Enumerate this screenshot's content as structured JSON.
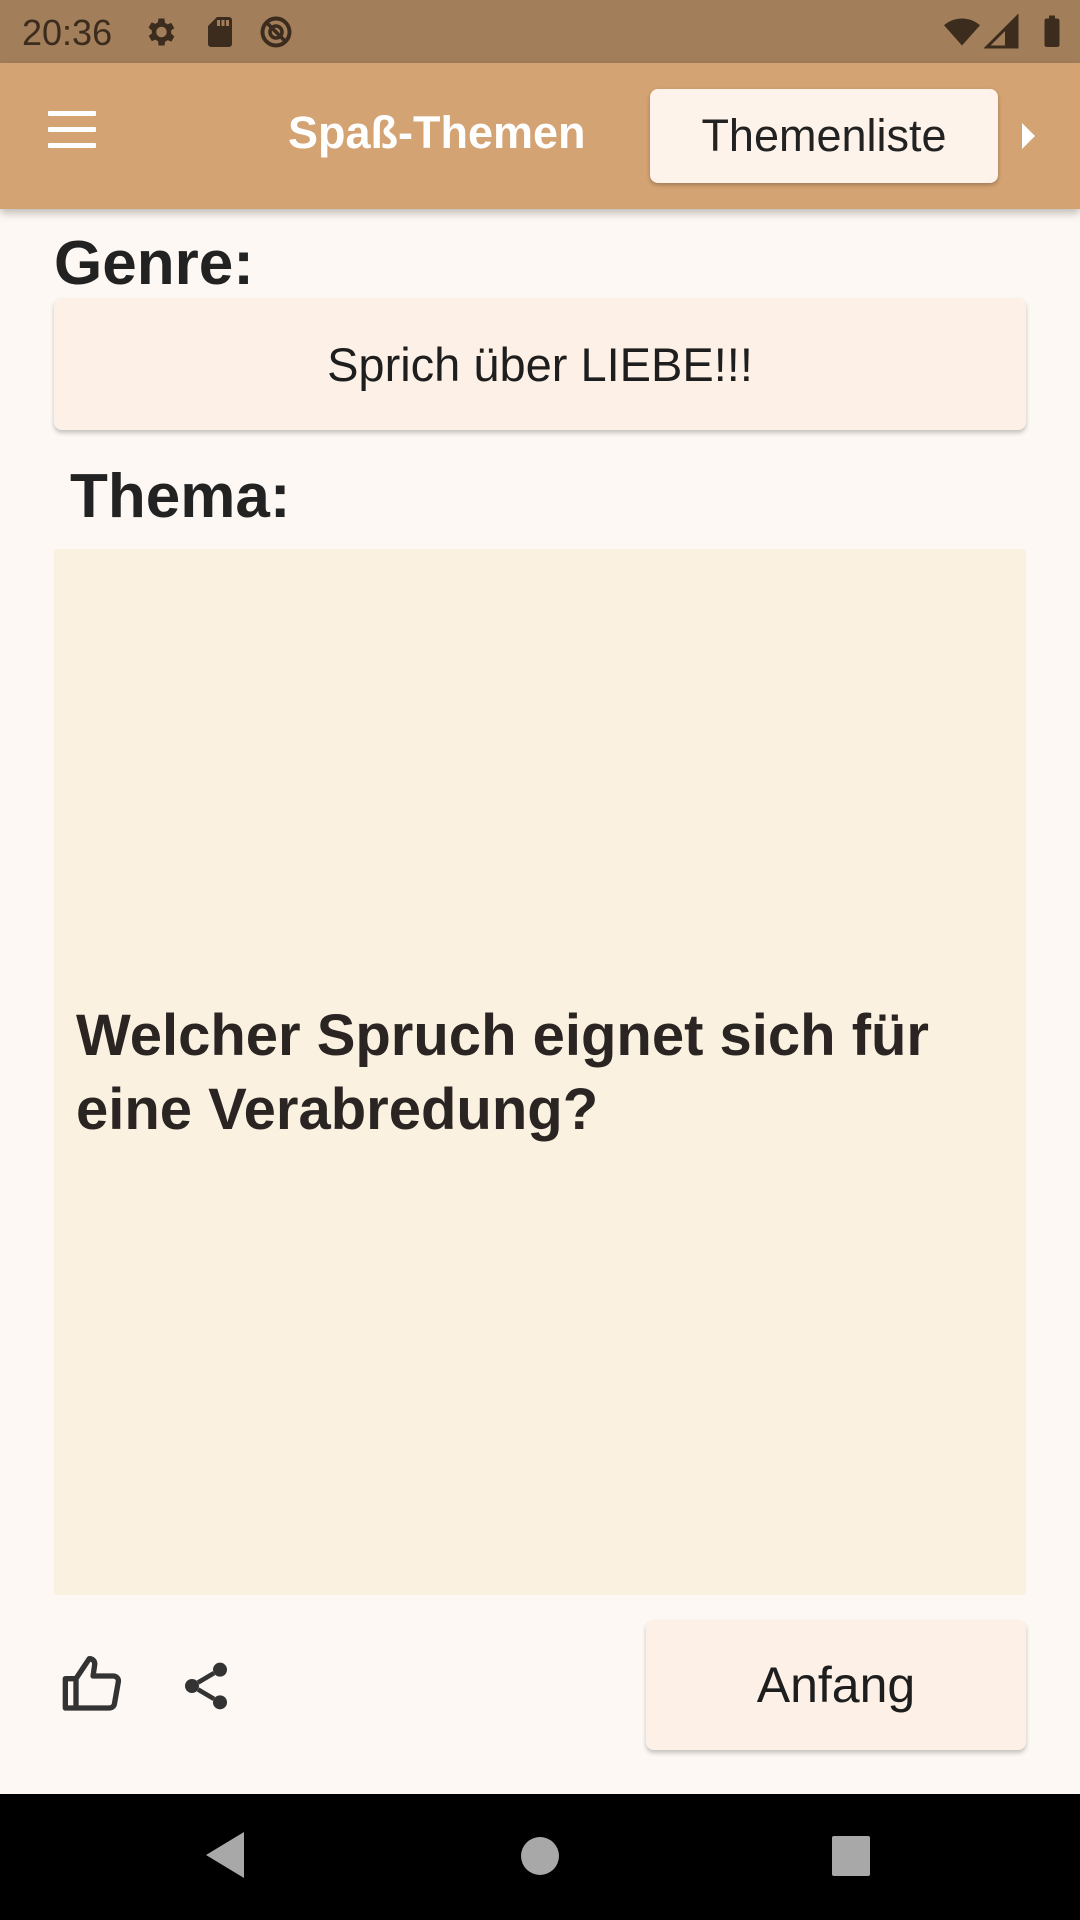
{
  "status_bar": {
    "time": "20:36",
    "icons": [
      "gear-icon",
      "sd-card-icon",
      "data-saver-icon",
      "wifi-icon",
      "signal-icon",
      "battery-icon"
    ]
  },
  "app_bar": {
    "menu_icon": "menu-icon",
    "title": "Spaß-Themen",
    "list_button_label": "Themenliste",
    "overflow_icon": "chevron-right-icon"
  },
  "genre": {
    "label": "Genre:",
    "value": "Sprich über LIEBE!!!"
  },
  "topic": {
    "label": "Thema:",
    "text": "Welcher Spruch eignet sich für eine Verabredung?"
  },
  "actions": {
    "like_icon": "thumbs-up-icon",
    "share_icon": "share-icon",
    "start_button_label": "Anfang"
  },
  "navigation": {
    "icons": [
      "back-icon",
      "home-icon",
      "recents-icon"
    ]
  },
  "colors": {
    "status_bar": "#a27e5b",
    "app_bar": "#d4a373",
    "button_bg": "#fdf1e7",
    "topic_bg": "#faf1e1",
    "page_bg": "#fdf8f3"
  }
}
